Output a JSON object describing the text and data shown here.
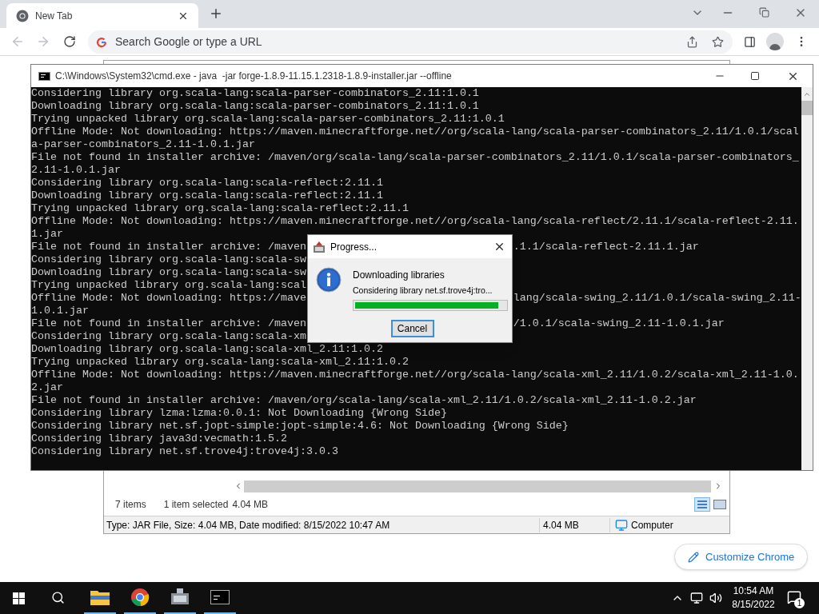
{
  "browser": {
    "tab": {
      "title": "New Tab"
    },
    "address": {
      "placeholder": "Search Google or type a URL"
    },
    "customize_button": "Customize Chrome"
  },
  "explorer": {
    "items_count": "7 items",
    "selection": "1 item selected",
    "selection_size": "4.04 MB",
    "details": "Type: JAR File, Size: 4.04 MB, Date modified: 8/15/2022 10:47 AM",
    "size": "4.04 MB",
    "zone": "Computer"
  },
  "console": {
    "title": "C:\\Windows\\System32\\cmd.exe - java  -jar forge-1.8.9-11.15.1.2318-1.8.9-installer.jar --offline",
    "lines": [
      {
        "kind": "full",
        "text": "Considering library org.scala-lang:scala-parser-combinators_2.11:1.0.1"
      },
      {
        "kind": "full",
        "text": "Downloading library org.scala-lang:scala-parser-combinators_2.11:1.0.1"
      },
      {
        "kind": "full",
        "text": "Trying unpacked library org.scala-lang:scala-parser-combinators_2.11:1.0.1"
      },
      {
        "kind": "full",
        "text": "Offline Mode: Not downloading: https://maven.minecraftforge.net//org/scala-lang/scala-parser-combinators_2.11/1.0.1/scal"
      },
      {
        "kind": "full",
        "text": "a-parser-combinators_2.11-1.0.1.jar"
      },
      {
        "kind": "full",
        "text": "File not found in installer archive: /maven/org/scala-lang/scala-parser-combinators_2.11/1.0.1/scala-parser-combinators_"
      },
      {
        "kind": "full",
        "text": "2.11-1.0.1.jar"
      },
      {
        "kind": "full",
        "text": "Considering library org.scala-lang:scala-reflect:2.11.1"
      },
      {
        "kind": "full",
        "text": "Downloading library org.scala-lang:scala-reflect:2.11.1"
      },
      {
        "kind": "full",
        "text": "Trying unpacked library org.scala-lang:scala-reflect:2.11.1"
      },
      {
        "kind": "full",
        "text": "Offline Mode: Not downloading: https://maven.minecraftforge.net//org/scala-lang/scala-reflect/2.11.1/scala-reflect-2.11."
      },
      {
        "kind": "full",
        "text": "1.jar"
      },
      {
        "kind": "split",
        "left": "File not found in installer archive: /maven",
        "right": ".1.1/scala-reflect-2.11.1.jar"
      },
      {
        "kind": "split",
        "left": "Considering library org.scala-lang:scala-sw"
      },
      {
        "kind": "split",
        "left": "Downloading library org.scala-lang:scala-sw"
      },
      {
        "kind": "split",
        "left": "Trying unpacked library org.scala-lang:scal"
      },
      {
        "kind": "split",
        "left": "Offline Mode: Not downloading: https://mave",
        "right": "lang/scala-swing_2.11/1.0.1/scala-swing_2.11-"
      },
      {
        "kind": "full",
        "text": "1.0.1.jar"
      },
      {
        "kind": "split",
        "left": "File not found in installer archive: /maven",
        "right": "/1.0.1/scala-swing_2.11-1.0.1.jar"
      },
      {
        "kind": "split",
        "left": "Considering library org.scala-lang:scala-xm"
      },
      {
        "kind": "full",
        "text": "Downloading library org.scala-lang:scala-xml_2.11:1.0.2"
      },
      {
        "kind": "full",
        "text": "Trying unpacked library org.scala-lang:scala-xml_2.11:1.0.2"
      },
      {
        "kind": "full",
        "text": "Offline Mode: Not downloading: https://maven.minecraftforge.net//org/scala-lang/scala-xml_2.11/1.0.2/scala-xml_2.11-1.0."
      },
      {
        "kind": "full",
        "text": "2.jar"
      },
      {
        "kind": "full",
        "text": "File not found in installer archive: /maven/org/scala-lang/scala-xml_2.11/1.0.2/scala-xml_2.11-1.0.2.jar"
      },
      {
        "kind": "full",
        "text": "Considering library lzma:lzma:0.0.1: Not Downloading {Wrong Side}"
      },
      {
        "kind": "full",
        "text": "Considering library net.sf.jopt-simple:jopt-simple:4.6: Not Downloading {Wrong Side}"
      },
      {
        "kind": "full",
        "text": "Considering library java3d:vecmath:1.5.2"
      },
      {
        "kind": "full",
        "text": "Considering library net.sf.trove4j:trove4j:3.0.3"
      }
    ]
  },
  "dialog": {
    "title": "Progress...",
    "heading": "Downloading libraries",
    "message": "Considering library net.sf.trove4j:tro...",
    "progress": {
      "level": 0.95
    },
    "button": "Cancel"
  },
  "taskbar": {
    "time": "10:54 AM",
    "date": "8/15/2022",
    "notifications": "1"
  }
}
